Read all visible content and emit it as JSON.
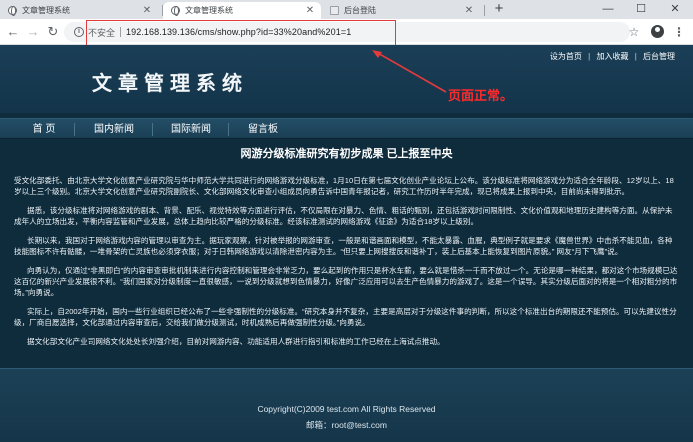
{
  "browser": {
    "tabs": [
      {
        "label": "文章管理系统",
        "active": false
      },
      {
        "label": "文章管理系统",
        "active": true
      },
      {
        "label": "后台登陆",
        "active": false
      }
    ],
    "new_tab": "+",
    "window_controls": {
      "minimize": "—",
      "maximize": "☐",
      "close": "✕"
    },
    "omnibox": {
      "security_label": "不安全",
      "url": "192.168.139.136/cms/show.php?id=33%20and%201=1"
    },
    "icons": [
      "back-icon",
      "forward-icon",
      "reload-icon",
      "info-icon",
      "star-icon",
      "account-icon",
      "menu-icon"
    ]
  },
  "site": {
    "top_links": [
      "设为首页",
      "加入收藏",
      "后台管理"
    ],
    "top_link_separator": "|",
    "logo": "文章管理系统",
    "annotation": "页面正常。",
    "nav": [
      "首 页",
      "国内新闻",
      "国际新闻",
      "留言板"
    ],
    "article": {
      "title": "网游分级标准研究有初步成果 已上报至中央",
      "paragraphs": [
        "受文化部委托、由北京大学文化创意产业研究院与华中师范大学共同进行的网络游戏分级标准，1月10日在第七届文化创业产业论坛上公布。该分级标准将网络游戏分为适合全年龄段、12岁以上、18岁以上三个级别。北京大学文化创意产业研究院副院长、文化部网络文化审查小组成员向勇告诉中国青年报记者，研究工作历时半年完成，现已将成果上报到中央，目前尚未得到批示。",
        "据悉，该分级标准将对网络游戏的剧本、背景、配乐、视觉特效等方面进行评估，不仅局限在对暴力、色情、粗话的甄别，还包括游戏时间限制性、文化价值观和地理历史建构等方面。从保护未成年人的立场出发，平衡内容监管和产业发展，总体上趋向比较严格的分级标准。经该标准测试的网络游戏《征途》为适合18岁以上级别。",
        "长期以来，我国对于网络游戏内容的管理以审查为主。据玩家观察，针对被举报的网游审查，一般是和谐画面和模型，不能太暴露、血腥，典型例子就是要求《魔兽世界》中击杀不能见血，各种技能图标不许有骷髅，一堆骨架的亡灵族也必须穿衣服；对于日韩网络游戏以清除泄密内容为主。“但只要上网搜搜反和谐补丁，装上后基本上能恢复到图片原貌。” 网友“月下飞鹰”说。",
        "向勇认为，仅通过“非黑即白”的内容审查审批机制来进行内容控制和管理会非常乏力，要么起到的作用只是杯水车薪，要么就是惜杀一千而不放过一个。无论是哪一种结果，都对这个市场规模已达这百亿的新兴产业发展很不利。“我们国家对分级制度一直很敏感，一说到分级就想到色情暴力，好像广泛应用可以去生产色情暴力的游戏了。这是一个误导。其实分级后面对的将是一个相对粗分的市场。”向勇说。",
        "实际上，自2002年开始，国内一些行业组织已经公布了一些非强制性的分级标准。“研究本身并不复杂，主要是高层对于分级这件事的判断，所以这个标准出台的期限还不能预估。可以先建议性分级，厂商自愿选择，文化部通过内容审查后，交给我们做分级测试，时机成熟后再做强制性分级。”向勇说。",
        "据文化部文化产业司网络文化处处长刘强介绍，目前对网游内容、功能适用人群进行指引和标准的工作已经在上海试点推动。"
      ]
    },
    "footer": {
      "copyright": "Copyright(C)2009 test.com All Rights Reserved",
      "email": "邮箱：root@test.com"
    }
  }
}
